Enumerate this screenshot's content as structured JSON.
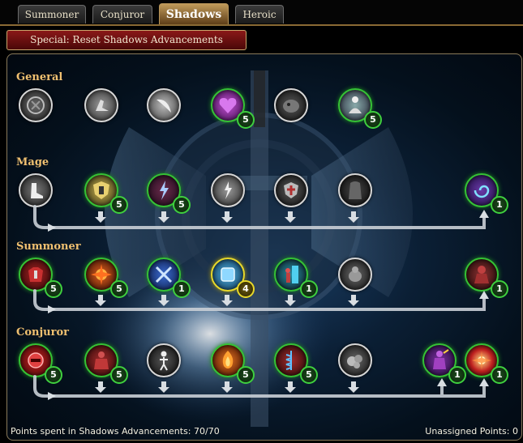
{
  "tabs": [
    {
      "label": "Summoner",
      "active": false
    },
    {
      "label": "Conjuror",
      "active": false
    },
    {
      "label": "Shadows",
      "active": true
    },
    {
      "label": "Heroic",
      "active": false
    }
  ],
  "reset_button": "Special: Reset Shadows Advancements",
  "sections": [
    {
      "title": "General",
      "skills": [
        {
          "icon": "rune-circle-icon",
          "style": "white"
        },
        {
          "icon": "boot-kick-icon",
          "style": "white"
        },
        {
          "icon": "claw-icon",
          "style": "white"
        },
        {
          "icon": "purple-heart-icon",
          "style": "green",
          "points": "5"
        },
        {
          "icon": "dark-beast-icon",
          "style": "white"
        },
        {
          "icon": "meditating-figure-icon",
          "style": "green",
          "points": "5"
        }
      ]
    },
    {
      "title": "Mage",
      "skills": [
        {
          "icon": "white-boot-icon",
          "style": "white"
        },
        {
          "icon": "golden-shield-icon",
          "style": "green",
          "points": "5"
        },
        {
          "icon": "lightning-strike-icon",
          "style": "green",
          "points": "5"
        },
        {
          "icon": "storm-icon",
          "style": "white"
        },
        {
          "icon": "crest-shield-icon",
          "style": "white"
        },
        {
          "icon": "dark-cloak-icon",
          "style": "white"
        },
        {
          "icon": "arcane-spiral-icon",
          "style": "green",
          "points": "1"
        }
      ]
    },
    {
      "title": "Summoner",
      "skills": [
        {
          "icon": "red-armor-icon",
          "style": "green",
          "points": "5"
        },
        {
          "icon": "fire-burst-icon",
          "style": "green",
          "points": "5"
        },
        {
          "icon": "blue-crossed-blades-icon",
          "style": "green",
          "points": "1"
        },
        {
          "icon": "ice-cube-icon",
          "style": "yellow",
          "points": "4"
        },
        {
          "icon": "portal-figure-icon",
          "style": "green",
          "points": "1"
        },
        {
          "icon": "shadow-creature-icon",
          "style": "white"
        },
        {
          "icon": "red-golem-icon",
          "style": "green",
          "points": "1"
        }
      ]
    },
    {
      "title": "Conjuror",
      "skills": [
        {
          "icon": "red-orb-icon",
          "style": "green",
          "points": "5"
        },
        {
          "icon": "red-golem-armor-icon",
          "style": "green",
          "points": "5"
        },
        {
          "icon": "skeleton-figure-icon",
          "style": "white"
        },
        {
          "icon": "flame-figure-icon",
          "style": "green",
          "points": "5"
        },
        {
          "icon": "blue-vortex-icon",
          "style": "green",
          "points": "5"
        },
        {
          "icon": "rock-cluster-icon",
          "style": "white"
        },
        {
          "icon": "purple-warrior-icon",
          "style": "green",
          "points": "1"
        },
        {
          "icon": "red-explosion-icon",
          "style": "green",
          "points": "1"
        }
      ]
    }
  ],
  "footer": {
    "points_spent": "Points spent in Shadows Advancements: 70/70",
    "unassigned": "Unassigned Points: 0"
  }
}
